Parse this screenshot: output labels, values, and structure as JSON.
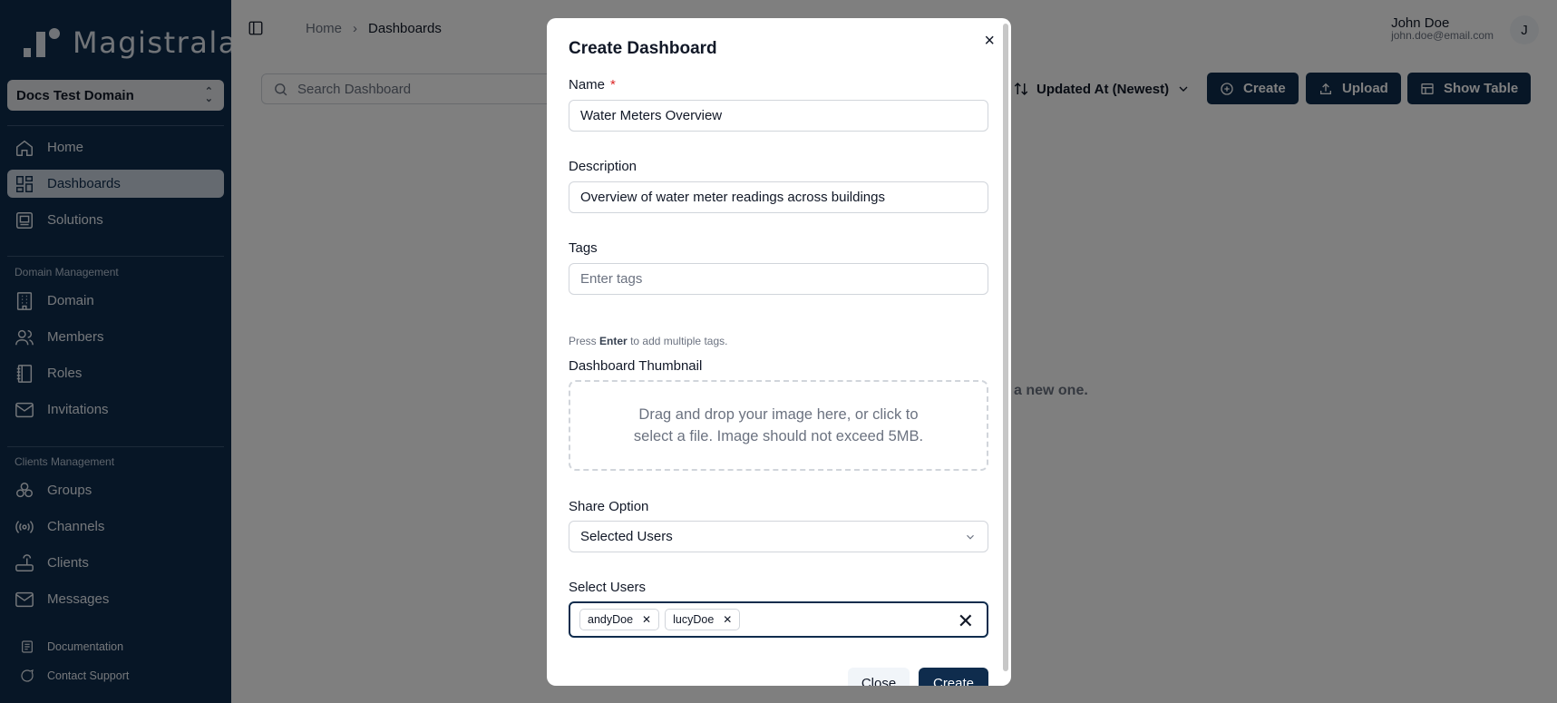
{
  "sidebar": {
    "logo_text": "Magistrala",
    "domain_selector": "Docs Test Domain",
    "nav": [
      {
        "label": "Home",
        "icon": "home-icon",
        "active": false
      },
      {
        "label": "Dashboards",
        "icon": "dashboard-icon",
        "active": true
      },
      {
        "label": "Solutions",
        "icon": "solutions-icon",
        "active": false
      }
    ],
    "domain_section_label": "Domain Management",
    "domain_nav": [
      {
        "label": "Domain",
        "icon": "building-icon"
      },
      {
        "label": "Members",
        "icon": "users-icon"
      },
      {
        "label": "Roles",
        "icon": "book-icon"
      },
      {
        "label": "Invitations",
        "icon": "mail-icon"
      }
    ],
    "clients_section_label": "Clients Management",
    "clients_nav": [
      {
        "label": "Groups",
        "icon": "groups-icon"
      },
      {
        "label": "Channels",
        "icon": "radio-icon"
      },
      {
        "label": "Clients",
        "icon": "router-icon"
      },
      {
        "label": "Messages",
        "icon": "mail-icon"
      }
    ],
    "footer": [
      {
        "label": "Documentation",
        "icon": "docs-icon"
      },
      {
        "label": "Contact Support",
        "icon": "chat-icon"
      }
    ]
  },
  "header": {
    "breadcrumb": [
      "Home",
      "Dashboards"
    ],
    "user_name": "John Doe",
    "user_email": "john.doe@email.com",
    "avatar_initial": "J"
  },
  "toolbar": {
    "search_placeholder": "Search Dashboard",
    "sort_label": "Updated At (Newest)",
    "create_label": "Create",
    "upload_label": "Upload",
    "show_table_label": "Show Table"
  },
  "empty_state_fragment": "a new one.",
  "modal": {
    "title": "Create Dashboard",
    "name_label": "Name",
    "name_required_mark": "*",
    "name_value": "Water Meters Overview",
    "description_label": "Description",
    "description_value": "Overview of water meter readings across buildings",
    "tags_label": "Tags",
    "tags_placeholder": "Enter tags",
    "tags_hint_prefix": "Press",
    "tags_hint_key": "Enter",
    "tags_hint_suffix": "to add multiple tags.",
    "thumbnail_label": "Dashboard Thumbnail",
    "thumbnail_dropzone_text": "Drag and drop your image here, or click to select a file. Image should not exceed 5MB.",
    "share_label": "Share Option",
    "share_value": "Selected Users",
    "users_label": "Select Users",
    "selected_users": [
      "andyDoe",
      "lucyDoe"
    ],
    "close_label": "Close",
    "create_label": "Create"
  },
  "colors": {
    "sidebar_bg": "#0f2c4d",
    "primary": "#0f2c4d",
    "required": "#dc2626"
  }
}
